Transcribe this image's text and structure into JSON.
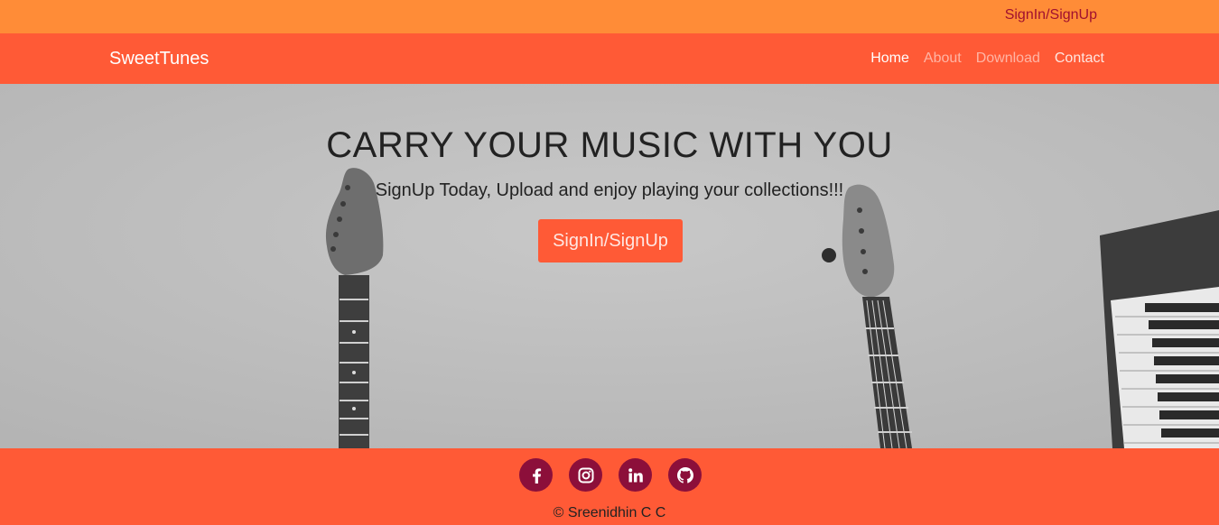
{
  "topbar": {
    "signin_label": "SignIn/SignUp"
  },
  "navbar": {
    "brand": "SweetTunes",
    "links": [
      "Home",
      "About",
      "Download",
      "Contact"
    ]
  },
  "hero": {
    "title": "CARRY YOUR MUSIC WITH YOU",
    "subtitle": "SignUp Today, Upload and enjoy playing your collections!!!",
    "cta_label": "SignIn/SignUp"
  },
  "footer": {
    "socials": [
      "facebook-icon",
      "instagram-icon",
      "linkedin-icon",
      "github-icon"
    ],
    "copyright": "© Sreenidhin C C"
  },
  "colors": {
    "topbar": "#ff8c37",
    "navbar": "#ff5a36",
    "accent": "#ff5a36",
    "social_bg": "#8c0f3a",
    "hero_bg": "#c2c2c2"
  }
}
